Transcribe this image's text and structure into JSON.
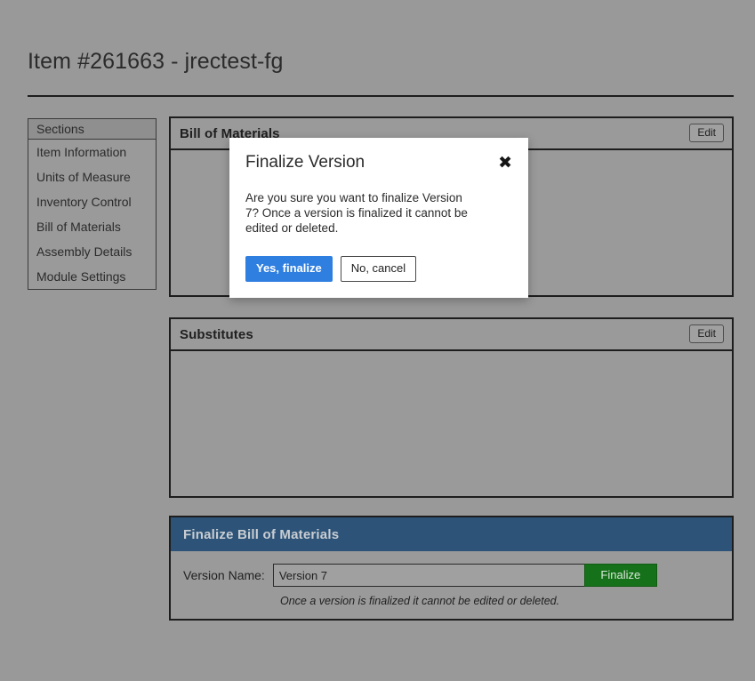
{
  "page": {
    "title": "Item #261663 - jrectest-fg",
    "background_color": "#999999"
  },
  "sidebar": {
    "header": "Sections",
    "items": [
      {
        "label": "Item Information"
      },
      {
        "label": "Units of Measure"
      },
      {
        "label": "Inventory Control"
      },
      {
        "label": "Bill of Materials"
      },
      {
        "label": "Assembly Details"
      },
      {
        "label": "Module Settings"
      }
    ]
  },
  "panels": {
    "bom": {
      "title": "Bill of Materials",
      "edit_label": "Edit"
    },
    "substitutes": {
      "title": "Substitutes",
      "edit_label": "Edit"
    },
    "finalize": {
      "title": "Finalize Bill of Materials",
      "header_color": "#2d5478",
      "version_label": "Version Name:",
      "version_value": "Version 7",
      "version_placeholder": "Version Name",
      "finalize_button": "Finalize",
      "finalize_button_color": "#16721a",
      "hint": "Once a version is finalized it cannot be edited or deleted."
    }
  },
  "modal": {
    "title": "Finalize Version",
    "close_icon": "✖",
    "body": "Are you sure you want to finalize Version 7? Once a version is finalized it cannot be edited or deleted.",
    "confirm_label": "Yes, finalize",
    "confirm_color": "#2f7fe0",
    "cancel_label": "No, cancel"
  }
}
